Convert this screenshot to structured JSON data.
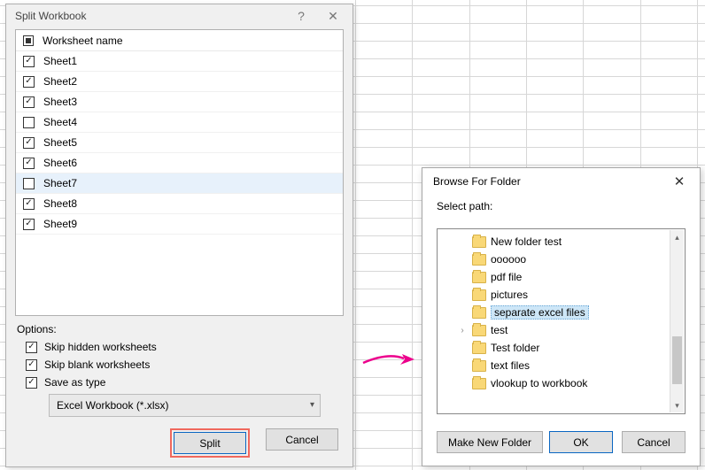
{
  "split_dialog": {
    "title": "Split Workbook",
    "header_label": "Worksheet name",
    "sheets": [
      {
        "name": "Sheet1",
        "checked": true
      },
      {
        "name": "Sheet2",
        "checked": true
      },
      {
        "name": "Sheet3",
        "checked": true
      },
      {
        "name": "Sheet4",
        "checked": false
      },
      {
        "name": "Sheet5",
        "checked": true
      },
      {
        "name": "Sheet6",
        "checked": true
      },
      {
        "name": "Sheet7",
        "checked": false,
        "hover": true
      },
      {
        "name": "Sheet8",
        "checked": true
      },
      {
        "name": "Sheet9",
        "checked": true
      }
    ],
    "options_label": "Options:",
    "opt_skip_hidden": "Skip hidden worksheets",
    "opt_skip_blank": "Skip blank worksheets",
    "opt_save_as": "Save as type",
    "save_as_value": "Excel Workbook (*.xlsx)",
    "split_btn": "Split",
    "cancel_btn": "Cancel"
  },
  "browse_dialog": {
    "title": "Browse For Folder",
    "select_path": "Select path:",
    "folders": [
      {
        "name": "New folder test"
      },
      {
        "name": "oooooo"
      },
      {
        "name": "pdf file"
      },
      {
        "name": "pictures"
      },
      {
        "name": "separate excel files",
        "selected": true
      },
      {
        "name": "test",
        "expandable": true
      },
      {
        "name": "Test folder"
      },
      {
        "name": "text files"
      },
      {
        "name": "vlookup to workbook"
      }
    ],
    "make_new_folder": "Make New Folder",
    "ok_btn": "OK",
    "cancel_btn": "Cancel"
  }
}
